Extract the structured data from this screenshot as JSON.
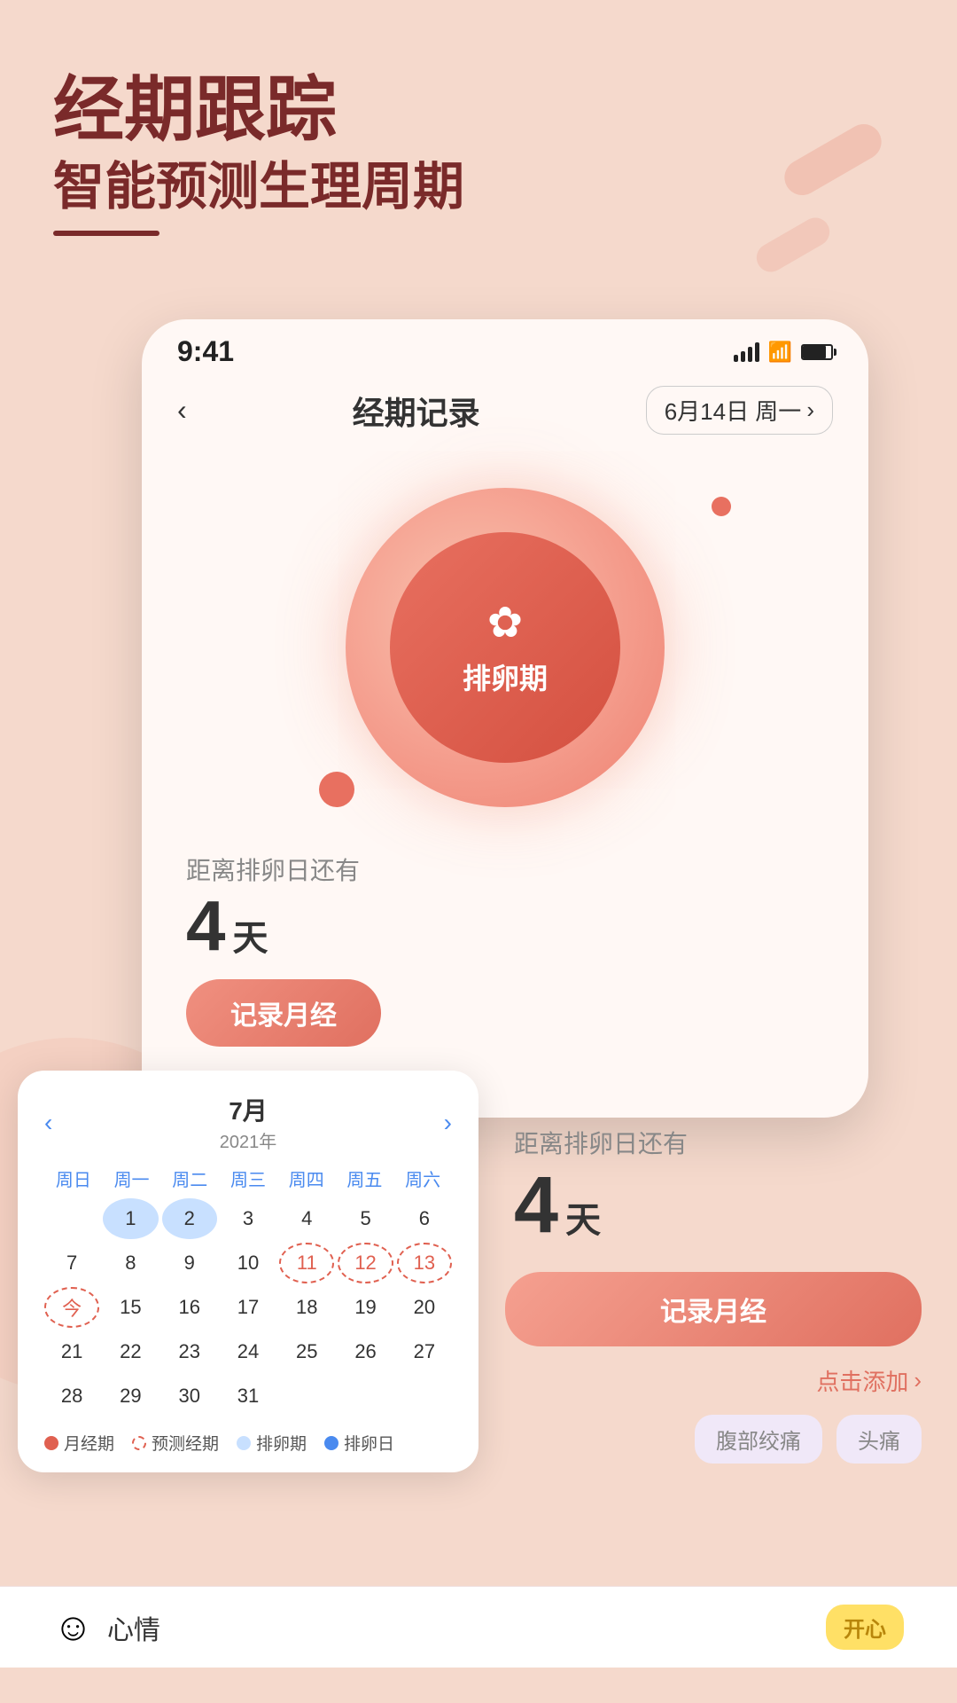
{
  "app": {
    "title_line1": "经期跟踪",
    "title_line2": "智能预测生理周期"
  },
  "status_bar": {
    "time": "9:41"
  },
  "nav": {
    "back_icon": "‹",
    "title": "经期记录",
    "date": "6月14日 周一",
    "arrow_right": "›"
  },
  "phase": {
    "label": "排卵期",
    "flower": "✿"
  },
  "countdown": {
    "label": "距离排卵日还有",
    "number": "4",
    "unit": "天"
  },
  "record_btn": "记录月经",
  "add_more": "点击添加",
  "symptoms": [
    "腹部绞痛",
    "头痛"
  ],
  "calendar": {
    "prev": "‹",
    "next": "›",
    "month": "7月",
    "year": "2021年",
    "weekdays": [
      "周日",
      "周一",
      "周二",
      "周三",
      "周四",
      "周五",
      "周六"
    ],
    "rows": [
      [
        "",
        "1",
        "2",
        "3",
        "4",
        "5",
        "6"
      ],
      [
        "7",
        "8",
        "9",
        "10",
        "11",
        "12",
        "13"
      ],
      [
        "今",
        "15",
        "16",
        "17",
        "18",
        "19",
        "20"
      ],
      [
        "21",
        "22",
        "23",
        "24",
        "25",
        "26",
        "27"
      ],
      [
        "28",
        "29",
        "30",
        "31",
        "",
        "",
        ""
      ]
    ],
    "legend": [
      {
        "color": "red",
        "label": "月经期"
      },
      {
        "color": "dashed-red",
        "label": "预测经期"
      },
      {
        "color": "light-blue",
        "label": "排卵期"
      },
      {
        "color": "blue",
        "label": "排卵日"
      }
    ]
  },
  "mood": {
    "emoji": "☺",
    "label": "心情",
    "badge": "开心"
  }
}
